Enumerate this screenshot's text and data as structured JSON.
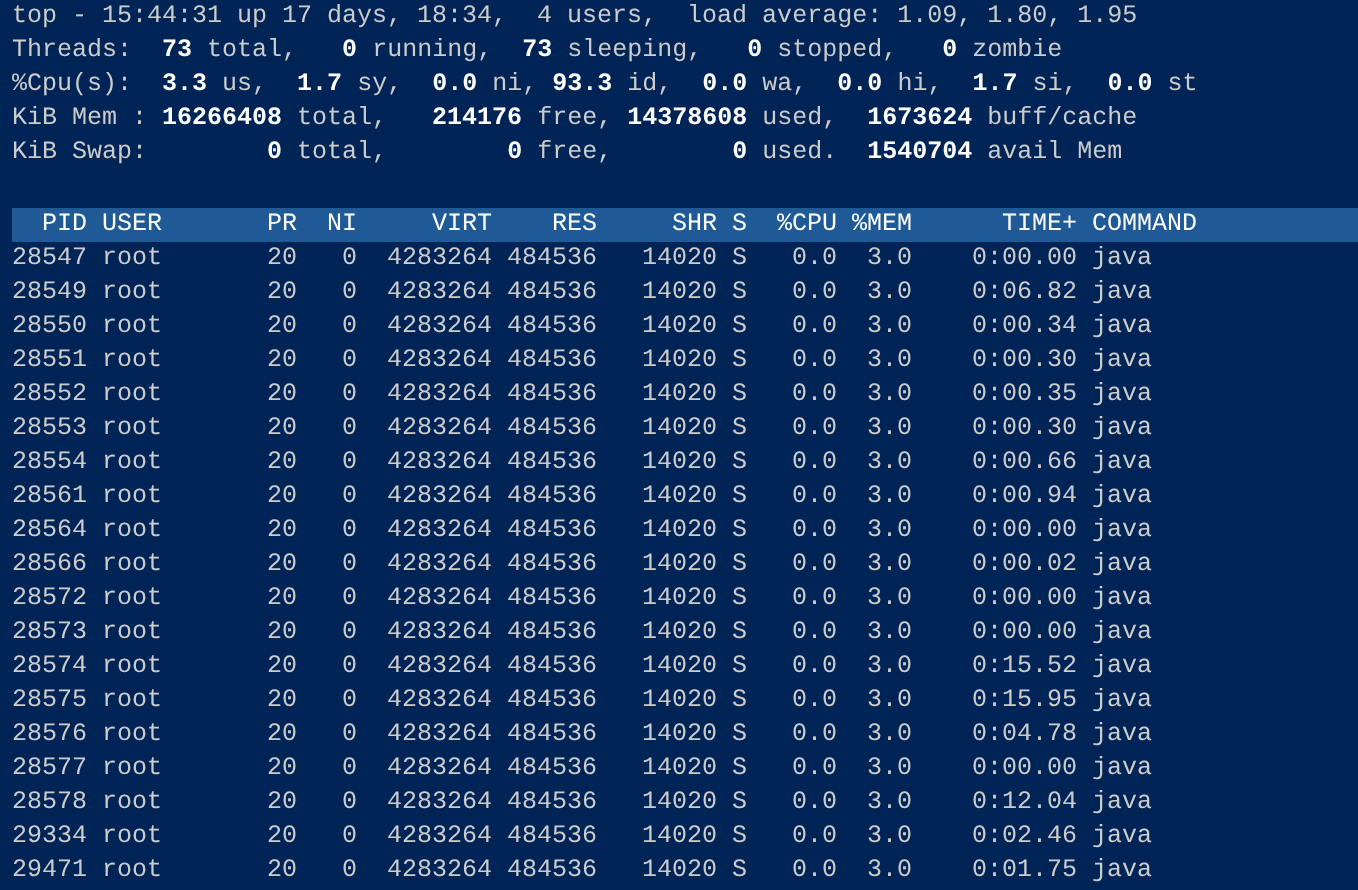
{
  "summary": [
    "top - 15:44:31 up 17 days, 18:34,  4 users,  load average: 1.09, 1.80, 1.95",
    "Threads:  **73** total,   **0** running,  **73** sleeping,   **0** stopped,   **0** zombie",
    "%Cpu(s):  **3.3** us,  **1.7** sy,  **0.0** ni, **93.3** id,  **0.0** wa,  **0.0** hi,  **1.7** si,  **0.0** st",
    "KiB Mem : **16266408** total,   **214176** free, **14378608** used,  **1673624** buff/cache",
    "KiB Swap:        **0** total,        **0** free,        **0** used.  **1540704** avail Mem"
  ],
  "table": {
    "columns": [
      "PID",
      "USER",
      "PR",
      "NI",
      "VIRT",
      "RES",
      "SHR",
      "S",
      "%CPU",
      "%MEM",
      "TIME+",
      "COMMAND"
    ],
    "rows": [
      [
        "28547",
        "root",
        "20",
        "0",
        "4283264",
        "484536",
        "14020",
        "S",
        "0.0",
        "3.0",
        "0:00.00",
        "java"
      ],
      [
        "28549",
        "root",
        "20",
        "0",
        "4283264",
        "484536",
        "14020",
        "S",
        "0.0",
        "3.0",
        "0:06.82",
        "java"
      ],
      [
        "28550",
        "root",
        "20",
        "0",
        "4283264",
        "484536",
        "14020",
        "S",
        "0.0",
        "3.0",
        "0:00.34",
        "java"
      ],
      [
        "28551",
        "root",
        "20",
        "0",
        "4283264",
        "484536",
        "14020",
        "S",
        "0.0",
        "3.0",
        "0:00.30",
        "java"
      ],
      [
        "28552",
        "root",
        "20",
        "0",
        "4283264",
        "484536",
        "14020",
        "S",
        "0.0",
        "3.0",
        "0:00.35",
        "java"
      ],
      [
        "28553",
        "root",
        "20",
        "0",
        "4283264",
        "484536",
        "14020",
        "S",
        "0.0",
        "3.0",
        "0:00.30",
        "java"
      ],
      [
        "28554",
        "root",
        "20",
        "0",
        "4283264",
        "484536",
        "14020",
        "S",
        "0.0",
        "3.0",
        "0:00.66",
        "java"
      ],
      [
        "28561",
        "root",
        "20",
        "0",
        "4283264",
        "484536",
        "14020",
        "S",
        "0.0",
        "3.0",
        "0:00.94",
        "java"
      ],
      [
        "28564",
        "root",
        "20",
        "0",
        "4283264",
        "484536",
        "14020",
        "S",
        "0.0",
        "3.0",
        "0:00.00",
        "java"
      ],
      [
        "28566",
        "root",
        "20",
        "0",
        "4283264",
        "484536",
        "14020",
        "S",
        "0.0",
        "3.0",
        "0:00.02",
        "java"
      ],
      [
        "28572",
        "root",
        "20",
        "0",
        "4283264",
        "484536",
        "14020",
        "S",
        "0.0",
        "3.0",
        "0:00.00",
        "java"
      ],
      [
        "28573",
        "root",
        "20",
        "0",
        "4283264",
        "484536",
        "14020",
        "S",
        "0.0",
        "3.0",
        "0:00.00",
        "java"
      ],
      [
        "28574",
        "root",
        "20",
        "0",
        "4283264",
        "484536",
        "14020",
        "S",
        "0.0",
        "3.0",
        "0:15.52",
        "java"
      ],
      [
        "28575",
        "root",
        "20",
        "0",
        "4283264",
        "484536",
        "14020",
        "S",
        "0.0",
        "3.0",
        "0:15.95",
        "java"
      ],
      [
        "28576",
        "root",
        "20",
        "0",
        "4283264",
        "484536",
        "14020",
        "S",
        "0.0",
        "3.0",
        "0:04.78",
        "java"
      ],
      [
        "28577",
        "root",
        "20",
        "0",
        "4283264",
        "484536",
        "14020",
        "S",
        "0.0",
        "3.0",
        "0:00.00",
        "java"
      ],
      [
        "28578",
        "root",
        "20",
        "0",
        "4283264",
        "484536",
        "14020",
        "S",
        "0.0",
        "3.0",
        "0:12.04",
        "java"
      ],
      [
        "29334",
        "root",
        "20",
        "0",
        "4283264",
        "484536",
        "14020",
        "S",
        "0.0",
        "3.0",
        "0:02.46",
        "java"
      ],
      [
        "29471",
        "root",
        "20",
        "0",
        "4283264",
        "484536",
        "14020",
        "S",
        "0.0",
        "3.0",
        "0:01.75",
        "java"
      ]
    ]
  }
}
